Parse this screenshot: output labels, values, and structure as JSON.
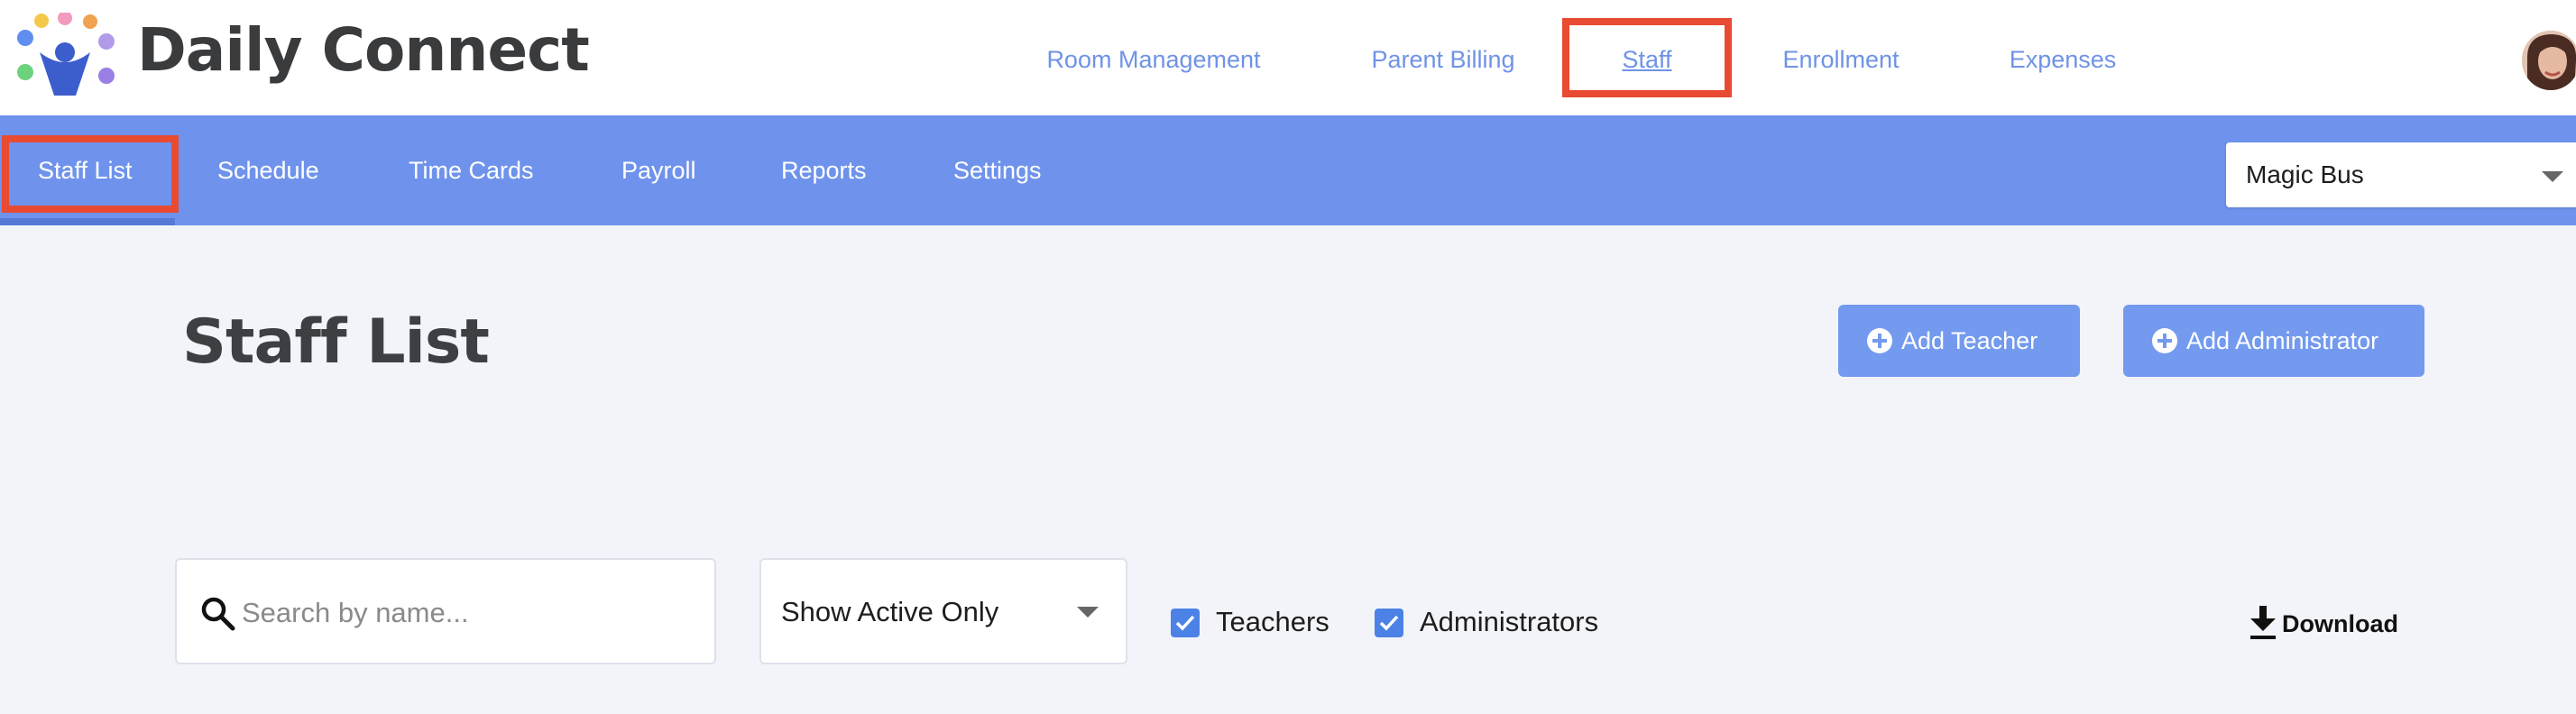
{
  "app": {
    "brand": "Daily Connect"
  },
  "top_nav": {
    "items": [
      {
        "label": "Room Management"
      },
      {
        "label": "Parent Billing"
      },
      {
        "label": "Staff",
        "active": true
      },
      {
        "label": "Enrollment"
      },
      {
        "label": "Expenses"
      }
    ]
  },
  "sub_nav": {
    "items": [
      {
        "label": "Staff List",
        "active": true
      },
      {
        "label": "Schedule"
      },
      {
        "label": "Time Cards"
      },
      {
        "label": "Payroll"
      },
      {
        "label": "Reports"
      },
      {
        "label": "Settings"
      }
    ],
    "location": "Magic Bus"
  },
  "main": {
    "title": "Staff List",
    "add_teacher_label": "Add Teacher",
    "add_admin_label": "Add Administrator",
    "search_placeholder": "Search by name...",
    "status_filter": "Show Active Only",
    "teachers_label": "Teachers",
    "teachers_checked": true,
    "administrators_label": "Administrators",
    "administrators_checked": true,
    "download_label": "Download"
  },
  "colors": {
    "accent": "#6f93ec",
    "link": "#6f93e6",
    "highlight": "#e84a32",
    "button": "#739aef",
    "checkbox": "#4c82e6"
  },
  "icons": [
    "logo-icon",
    "avatar",
    "search-icon",
    "caret-down-icon",
    "plus-circle-icon",
    "download-icon",
    "checkmark-icon"
  ]
}
